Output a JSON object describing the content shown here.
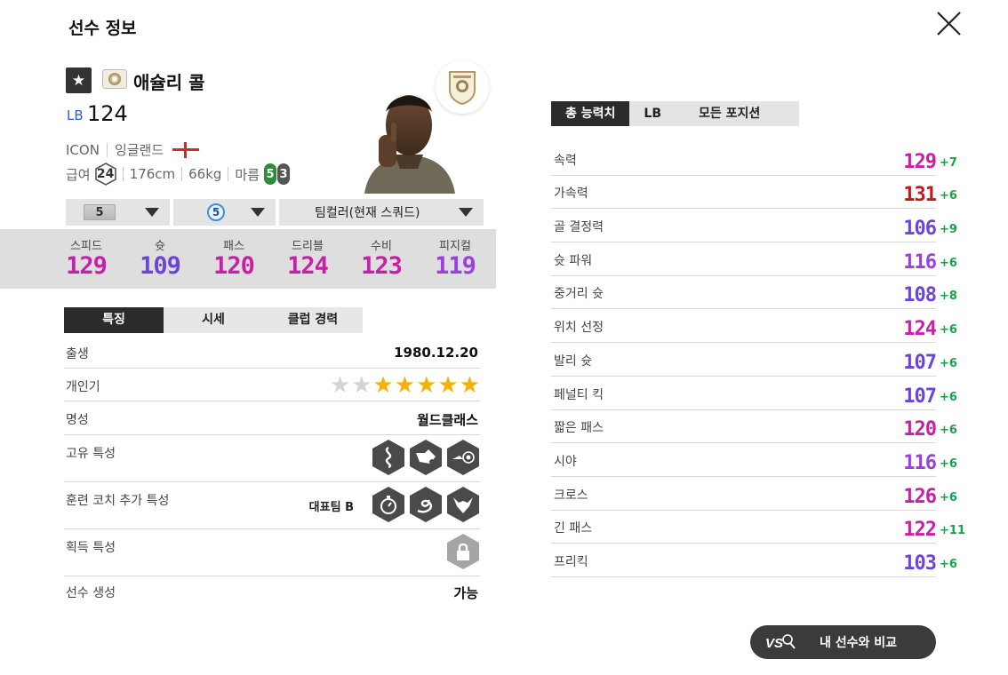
{
  "header": {
    "title": "선수 정보",
    "close_icon": "close-icon"
  },
  "player": {
    "name": "애슐리 콜",
    "position": "LB",
    "ovr": "124",
    "season": "ICON",
    "nation": "잉글랜드",
    "salary_label": "급여",
    "salary": "24",
    "height": "176cm",
    "weight": "66kg",
    "body_type": "마름",
    "weak_foot_left": "5",
    "weak_foot_right": "3"
  },
  "dropdowns": {
    "upgrade_level": "5",
    "adaptability": "5",
    "team_color": "팀컬러(현재 스쿼드)"
  },
  "summary_stats": [
    {
      "label": "스피드",
      "value": "129",
      "color": "#c81fa7"
    },
    {
      "label": "슛",
      "value": "109",
      "color": "#6b45d8"
    },
    {
      "label": "패스",
      "value": "120",
      "color": "#c81fa7"
    },
    {
      "label": "드리블",
      "value": "124",
      "color": "#c81fa7"
    },
    {
      "label": "수비",
      "value": "123",
      "color": "#c81fa7"
    },
    {
      "label": "피지컬",
      "value": "119",
      "color": "#9b3fe0"
    }
  ],
  "tabs": [
    "특징",
    "시세",
    "클럽 경력"
  ],
  "info": {
    "birth_label": "출생",
    "birth_value": "1980.12.20",
    "popularity_label": "개인기",
    "popularity_stars": 5,
    "popularity_max": 7,
    "fame_label": "명성",
    "fame_value": "월드클래스",
    "unique_traits_label": "고유 특성",
    "coach_traits_label": "훈련 코치 추가 특성",
    "coach_traits_value": "대표팀 B",
    "acquired_traits_label": "획득 특성",
    "create_label": "선수 생성",
    "create_value": "가능"
  },
  "right_tabs": [
    "총 능력치",
    "LB",
    "모든 포지션"
  ],
  "attributes": [
    {
      "name": "속력",
      "value": "129",
      "bonus": "+7",
      "color": "#c81fa7"
    },
    {
      "name": "가속력",
      "value": "131",
      "bonus": "+6",
      "color": "#c4161c"
    },
    {
      "name": "골 결정력",
      "value": "106",
      "bonus": "+9",
      "color": "#6b45d8"
    },
    {
      "name": "슛 파워",
      "value": "116",
      "bonus": "+6",
      "color": "#9b3fe0"
    },
    {
      "name": "중거리 슛",
      "value": "108",
      "bonus": "+8",
      "color": "#6b45d8"
    },
    {
      "name": "위치 선정",
      "value": "124",
      "bonus": "+6",
      "color": "#c81fa7"
    },
    {
      "name": "발리 슛",
      "value": "107",
      "bonus": "+6",
      "color": "#6b45d8"
    },
    {
      "name": "페널티 킥",
      "value": "107",
      "bonus": "+6",
      "color": "#6b45d8"
    },
    {
      "name": "짧은 패스",
      "value": "120",
      "bonus": "+6",
      "color": "#c81fa7"
    },
    {
      "name": "시야",
      "value": "116",
      "bonus": "+6",
      "color": "#9b3fe0"
    },
    {
      "name": "크로스",
      "value": "126",
      "bonus": "+6",
      "color": "#c81fa7"
    },
    {
      "name": "긴 패스",
      "value": "122",
      "bonus": "+11",
      "color": "#c81fa7"
    },
    {
      "name": "프리킥",
      "value": "103",
      "bonus": "+6",
      "color": "#6b45d8"
    }
  ],
  "compare_button": "내 선수와 비교"
}
